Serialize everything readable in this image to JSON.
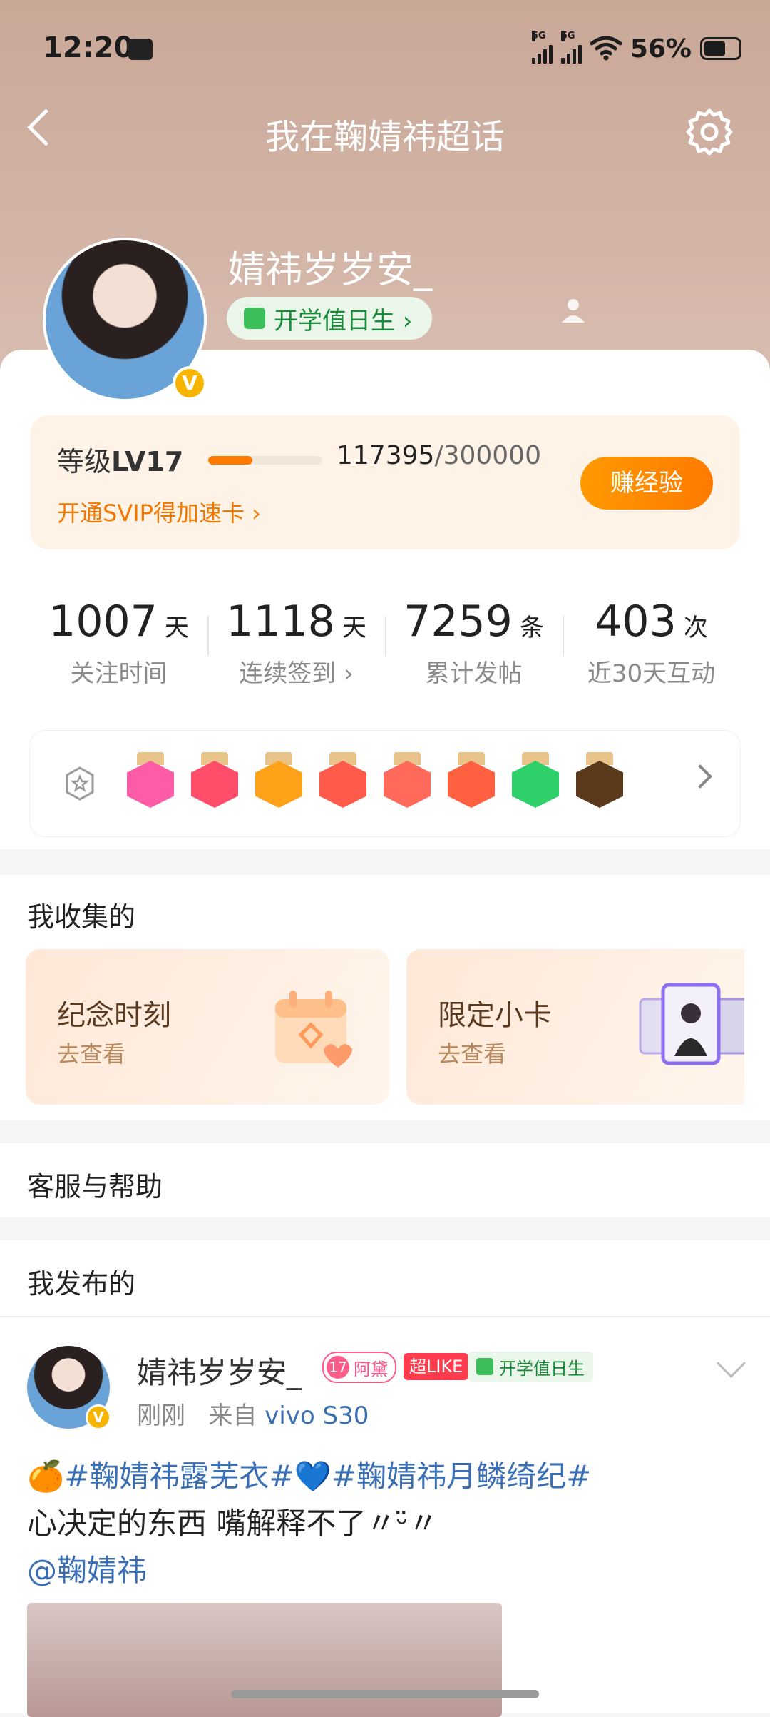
{
  "status_bar": {
    "time": "12:20",
    "signal1": "5G",
    "signal2": "5G",
    "battery": "56%"
  },
  "header": {
    "title": "我在鞠婧祎超话"
  },
  "profile": {
    "name": "婧祎岁岁安_",
    "tag": "开学值日生 ›",
    "verified": "V"
  },
  "level": {
    "label_prefix": "等级",
    "level": "LV17",
    "progress": 0.39,
    "current": "117395",
    "total": "/300000",
    "svip_link": "开通SVIP得加速卡 ›",
    "earn_button": "赚经验"
  },
  "stats": [
    {
      "value": "1007",
      "unit": "天",
      "label": "关注时间"
    },
    {
      "value": "1118",
      "unit": "天",
      "label": "连续签到 ›"
    },
    {
      "value": "7259",
      "unit": "条",
      "label": "累计发帖"
    },
    {
      "value": "403",
      "unit": "次",
      "label": "近30天互动"
    }
  ],
  "medals": [
    {
      "name": "lv17-medal-icon",
      "color": "#ff5ca8"
    },
    {
      "name": "trophy-medal-icon",
      "color": "#ff4d6a"
    },
    {
      "name": "crown-medal-icon",
      "color": "#ffa21a"
    },
    {
      "name": "cat-medal-icon",
      "color": "#ff5a4a"
    },
    {
      "name": "cat-face-medal-icon",
      "color": "#ff6a5a"
    },
    {
      "name": "fire-cat-medal-icon",
      "color": "#ff6040"
    },
    {
      "name": "wing-medal-icon",
      "color": "#2ed06a"
    },
    {
      "name": "super-medal-icon",
      "color": "#5a3a1a"
    }
  ],
  "collect": {
    "title": "我收集的",
    "cards": [
      {
        "title": "纪念时刻",
        "sub": "去查看"
      },
      {
        "title": "限定小卡",
        "sub": "去查看"
      }
    ]
  },
  "help": {
    "title": "客服与帮助"
  },
  "posts_section": {
    "title": "我发布的"
  },
  "post": {
    "author": "婧祎岁岁安_",
    "fan_badge_num": "17",
    "fan_badge_name": "阿黛",
    "like_badge": "超LIKE",
    "school_badge": "开学值日生",
    "time": "刚刚",
    "from_prefix": "来自",
    "device": "vivo S30",
    "emoji1": "🍊",
    "tag1": "#鞠婧祎露芜衣#",
    "emoji2": "💙",
    "tag2": "#鞠婧祎月鳞绮纪#",
    "text": "心决定的东西 嘴解释不了〃ᵕ̈〃",
    "mention": "@鞠婧祎"
  }
}
